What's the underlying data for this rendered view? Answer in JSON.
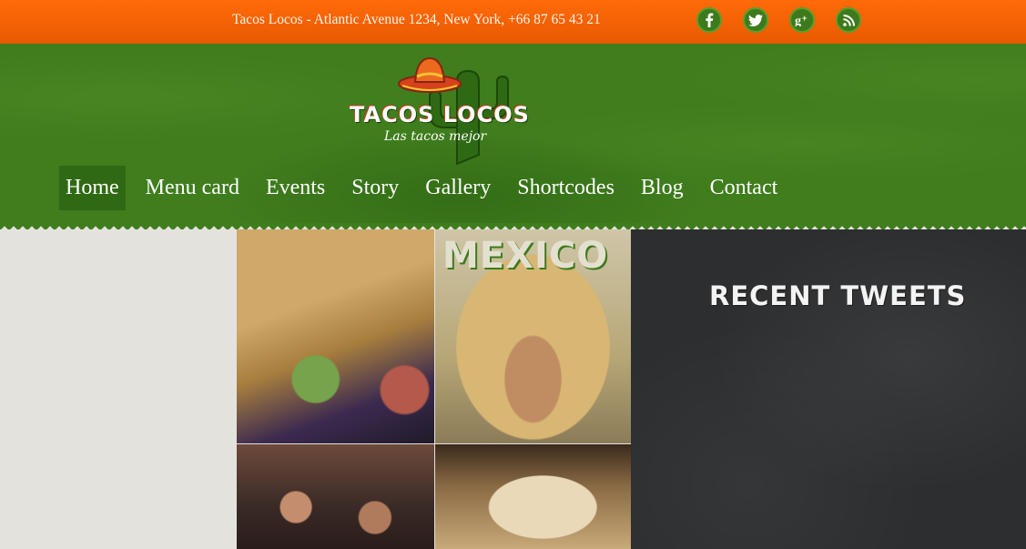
{
  "topbar": {
    "contact": "Tacos Locos - Atlantic Avenue 1234, New York, +66 87 65 43 21",
    "social": [
      {
        "name": "facebook",
        "icon": "facebook-icon"
      },
      {
        "name": "twitter",
        "icon": "twitter-icon"
      },
      {
        "name": "google-plus",
        "icon": "google-plus-icon"
      },
      {
        "name": "rss",
        "icon": "rss-icon"
      }
    ],
    "colors": {
      "bar": "#e85a00",
      "button": "#3d7a1c"
    }
  },
  "logo": {
    "brand": "TACOS LOCOS",
    "tagline": "Las tacos mejor",
    "icon": "sombrero-cactus-logo"
  },
  "nav": {
    "items": [
      {
        "label": "Home",
        "active": true
      },
      {
        "label": "Menu card"
      },
      {
        "label": "Events"
      },
      {
        "label": "Story"
      },
      {
        "label": "Gallery"
      },
      {
        "label": "Shortcodes"
      },
      {
        "label": "Blog"
      },
      {
        "label": "Contact"
      }
    ],
    "colors": {
      "background": "#3f7d1d",
      "active": "#2f6913"
    }
  },
  "gallery": {
    "tiles": [
      {
        "name": "quesadilla-photo"
      },
      {
        "name": "mexico-sombrero-photo",
        "text": "MEXICO"
      },
      {
        "name": "crowd-photo"
      },
      {
        "name": "tacos-photo"
      }
    ]
  },
  "sidebar": {
    "title": "Recent tweets"
  }
}
